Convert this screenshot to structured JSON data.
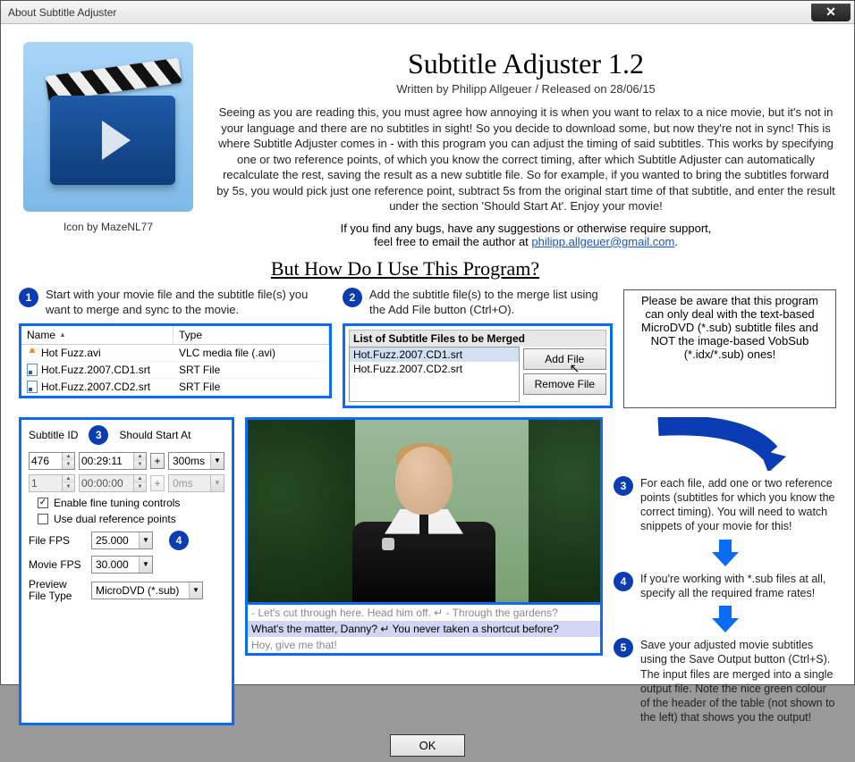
{
  "window": {
    "title": "About Subtitle Adjuster",
    "close": "✕"
  },
  "header": {
    "app_title": "Subtitle Adjuster 1.2",
    "byline": "Written by Philipp Allgeuer / Released on 28/06/15",
    "icon_credit": "Icon by MazeNL77",
    "intro": "Seeing as you are reading this, you must agree how annoying it is when you want to relax to a nice movie, but it's not in your language and there are no subtitles in sight! So you decide to download some, but now they're not in sync! This is where Subtitle Adjuster comes in - with this program you can adjust the timing of said subtitles. This works by specifying one or two reference points, of which you know the correct timing, after which Subtitle Adjuster can automatically recalculate the rest, saving the result as a new subtitle file. So for example, if you wanted to bring the subtitles forward by 5s, you would pick just one reference point, subtract 5s from the original start time of that subtitle, and enter the result under the section 'Should Start At'. Enjoy your movie!",
    "support": "If you find any bugs, have any suggestions or otherwise require support,",
    "email_pre": "feel free to email the author at ",
    "email": "philipp.allgeuer@gmail.com",
    "email_post": "."
  },
  "howto_heading": "But How Do I Use This Program?",
  "steps": {
    "s1": "Start with your movie file and the subtitle file(s) you want to merge and sync to the movie.",
    "s2": "Add the subtitle file(s) to the merge list using the Add File button (Ctrl+O).",
    "note": "Please be aware that this program can only deal with the text-based MicroDVD (*.sub) subtitle files and NOT the image-based VobSub (*.idx/*.sub) ones!",
    "s3": "For each file, add one or two reference points (subtitles for which you know the correct timing). You will need to watch snippets of your movie for this!",
    "s4": "If you're working with *.sub files at all, specify all the required frame rates!",
    "s5": "Save your adjusted movie subtitles using the Save Output button (Ctrl+S). The input files are merged into a single output file. Note the nice green colour of the header of the table (not shown to the left) that shows you the output!"
  },
  "file_table": {
    "col_name": "Name",
    "col_type": "Type",
    "rows": [
      {
        "name": "Hot Fuzz.avi",
        "type": "VLC media file (.avi)",
        "icon": "vlc"
      },
      {
        "name": "Hot.Fuzz.2007.CD1.srt",
        "type": "SRT File",
        "icon": "srt"
      },
      {
        "name": "Hot.Fuzz.2007.CD2.srt",
        "type": "SRT File",
        "icon": "srt"
      }
    ]
  },
  "merge": {
    "title": "List of Subtitle Files to be Merged",
    "items": [
      "Hot.Fuzz.2007.CD1.srt",
      "Hot.Fuzz.2007.CD2.srt"
    ],
    "add": "Add File",
    "remove": "Remove File"
  },
  "panel3": {
    "sub_id_lbl": "Subtitle ID",
    "should_start_lbl": "Should Start At",
    "row1": {
      "id": "476",
      "time": "00:29:11",
      "ms": "300ms"
    },
    "row2": {
      "id": "1",
      "time": "00:00:00",
      "ms": "0ms"
    },
    "cb_fine": "Enable fine tuning controls",
    "cb_dual": "Use dual reference points",
    "file_fps_lbl": "File FPS",
    "file_fps": "25.000",
    "movie_fps_lbl": "Movie FPS",
    "movie_fps": "30.000",
    "preview_lbl": "Preview File Type",
    "preview_val": "MicroDVD (*.sub)"
  },
  "subtitles": {
    "l1": "- Let's cut through here. Head him off. ↵ - Through the gardens?",
    "l2": "What's the matter, Danny? ↵ You never taken a shortcut before?",
    "l3": "Hoy, give me that!"
  },
  "ok": "OK"
}
